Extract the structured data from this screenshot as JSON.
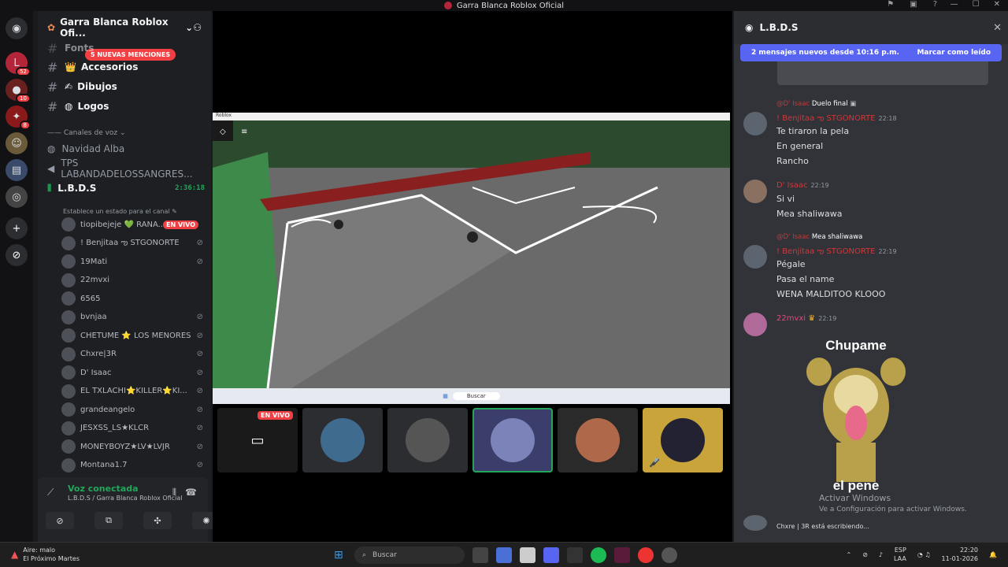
{
  "window": {
    "title": "Garra Blanca Roblox Oficial"
  },
  "rail": {
    "items": [
      {
        "icon": "discord-home-icon",
        "badge": ""
      },
      {
        "icon": "server-lmd-icon",
        "badge": "52"
      },
      {
        "icon": "server-icon-2",
        "badge": "10"
      },
      {
        "icon": "server-icon-3",
        "badge": "8"
      },
      {
        "icon": "server-icon-4",
        "badge": ""
      },
      {
        "icon": "server-icon-5",
        "badge": ""
      },
      {
        "icon": "server-icon-6",
        "badge": ""
      },
      {
        "icon": "add-server-icon",
        "badge": ""
      },
      {
        "icon": "explore-icon",
        "badge": ""
      }
    ]
  },
  "sidebar": {
    "server_name": "Garra Blanca Roblox Ofi...",
    "mentions": "5 NUEVAS MENCIONES",
    "channels": [
      {
        "label": "Fonts"
      },
      {
        "label": "Accesorios"
      },
      {
        "label": "Dibujos"
      },
      {
        "label": "Logos"
      }
    ],
    "voice_category": "Canales de voz",
    "voice_channels": [
      {
        "label": "Navidad Alba"
      },
      {
        "label": "TPS LABANDADELOSSANGRES..."
      },
      {
        "label": "L.B.D.S",
        "timer": "2:36:18"
      }
    ],
    "channel_status": "Establece un estado para el canal",
    "members": [
      {
        "name": "tiopibejeje 💚 RANA...",
        "live": "EN VIVO"
      },
      {
        "name": "! Benjitaa ఌ STGONORTE",
        "live": ""
      },
      {
        "name": "19Mati",
        "live": ""
      },
      {
        "name": "22mvxi",
        "live": ""
      },
      {
        "name": "6565",
        "live": ""
      },
      {
        "name": "bvnjaa",
        "live": ""
      },
      {
        "name": "CHETUME ⭐ LOS MENORES",
        "live": ""
      },
      {
        "name": "Chxre|3R",
        "live": ""
      },
      {
        "name": "D' Isaac",
        "live": ""
      },
      {
        "name": "EL TXLACHI⭐KILLER⭐KI...",
        "live": ""
      },
      {
        "name": "grandeangelo",
        "live": ""
      },
      {
        "name": "JESXSS_LS★KLCR",
        "live": ""
      },
      {
        "name": "MONEYBOYZ★LV★LVJR",
        "live": ""
      },
      {
        "name": "Montana1.7",
        "live": ""
      }
    ],
    "voice_panel": {
      "title": "Voz conectada",
      "subtitle": "L.B.D.S / Garra Blanca Roblox Oficial"
    }
  },
  "stage": {
    "stream_window_title": "Roblox",
    "taskbar_search": "Buscar",
    "thumb_live": "EN VIVO"
  },
  "chat": {
    "channel": "L.B.D.S",
    "new_messages": "2 mensajes nuevos desde 10:16 p.m.",
    "mark_read": "Marcar como leído",
    "messages": [
      {
        "reply_user": "@D' Isaac",
        "reply_text": "Duelo final",
        "user": "! Benjitaa ఌ STGONORTE",
        "time": "22:18",
        "lines": [
          "Te tiraron la pela",
          "En general",
          "Rancho"
        ]
      },
      {
        "reply_user": "",
        "reply_text": "",
        "user": "D' Isaac",
        "time": "22:19",
        "lines": [
          "Si vi",
          "Mea shaliwawa"
        ]
      },
      {
        "reply_user": "@D' Isaac",
        "reply_text": "Mea shaliwawa",
        "user": "! Benjitaa ఌ STGONORTE",
        "time": "22:19",
        "lines": [
          "Pégale",
          "Pasa el name",
          "WENA MALDITOO KLOOO"
        ]
      },
      {
        "reply_user": "",
        "reply_text": "",
        "user": "22mvxi",
        "time": "22:19",
        "lines": []
      }
    ],
    "sticker_top": "Chupame",
    "sticker_bottom": "el pene",
    "typing": "Chxre | 3R está escribiendo...",
    "activate_1": "Activar Windows",
    "activate_2": "Ve a Configuración para activar Windows."
  },
  "taskbar": {
    "weather_line1": "Aire: malo",
    "weather_line2": "El Próximo Martes",
    "search": "Buscar",
    "lang1": "ESP",
    "lang2": "LAA",
    "time": "22:20",
    "date": "11-01-2026"
  }
}
